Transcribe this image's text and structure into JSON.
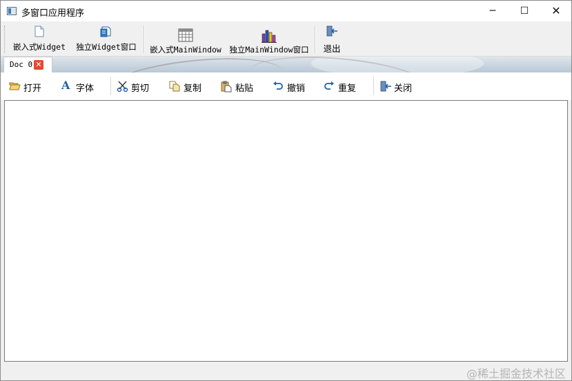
{
  "window": {
    "title": "多窗口应用程序",
    "min_icon": "─",
    "max_icon": "☐",
    "close_icon": "✕"
  },
  "toolbar": {
    "embed_widget": "嵌入式Widget",
    "standalone_widget": "独立Widget窗口",
    "embed_mainwindow": "嵌入式MainWindow",
    "standalone_mainwindow": "独立MainWindow窗口",
    "exit": "退出"
  },
  "tabs": [
    {
      "label": "Doc 0",
      "close": "✕"
    }
  ],
  "edit_toolbar": {
    "open": "打开",
    "font": "字体",
    "font_glyph": "A",
    "cut": "剪切",
    "copy": "复制",
    "paste": "粘贴",
    "undo": "撤销",
    "redo": "重复",
    "close": "关闭"
  },
  "editor": {
    "content": ""
  },
  "watermark": "@稀土掘金技术社区",
  "colors": {
    "tab_close": "#e24a2d",
    "icon_blue": "#1f5fa8"
  }
}
